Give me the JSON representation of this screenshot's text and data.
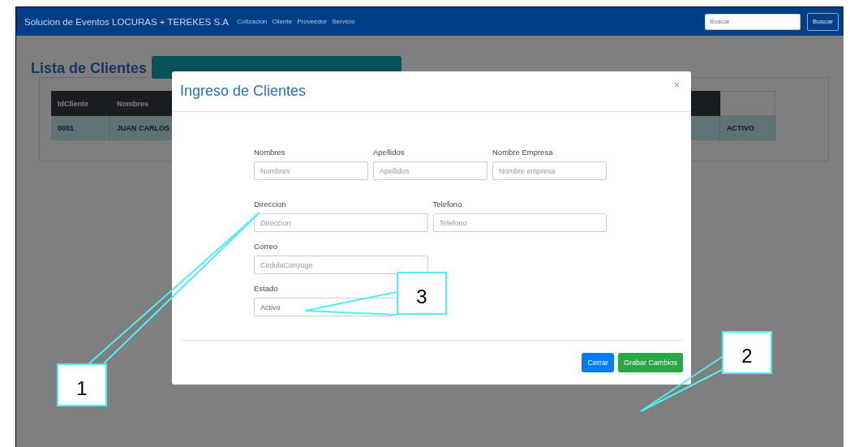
{
  "navbar": {
    "brand": "Solucion de Eventos LOCURAS + TEREKES S.A",
    "links": [
      "Cotizacion",
      "Cliente",
      "Proveedor",
      "Servicio"
    ],
    "search": {
      "placeholder": "Buscar"
    },
    "search_button": "Buscar"
  },
  "page": {
    "title": "Lista de Clientes"
  },
  "table": {
    "columns": [
      "IdCliente",
      "Nombres"
    ],
    "rows": [
      {
        "id": "0001",
        "nombres": "JUAN CARLOS",
        "estado": "ACTIVO"
      }
    ]
  },
  "modal": {
    "title": "Ingreso de Clientes",
    "close": "×",
    "field_rows": [
      [
        {
          "label": "Nombres",
          "placeholder": "Nombres",
          "kind": "input"
        },
        {
          "label": "Apellidos",
          "placeholder": "Apellidos",
          "kind": "input"
        },
        {
          "label": "Nombre Empresa",
          "placeholder": "Nombre empresa",
          "kind": "input"
        }
      ],
      [
        {
          "label": "Direccion",
          "placeholder": "Direccion",
          "kind": "input"
        },
        {
          "label": "Telefono",
          "placeholder": "Telefono",
          "kind": "input"
        }
      ],
      [
        {
          "label": "Correo",
          "placeholder": "CedulaConyuge",
          "kind": "input"
        }
      ],
      [
        {
          "label": "Estado",
          "value": "Activo",
          "kind": "select"
        }
      ]
    ],
    "buttons": [
      {
        "label": "Cerrar",
        "kind": "primary"
      },
      {
        "label": "Grabar Cambios",
        "kind": "success"
      }
    ]
  },
  "annotations": [
    {
      "label": "1"
    },
    {
      "label": "2"
    },
    {
      "label": "3"
    }
  ]
}
